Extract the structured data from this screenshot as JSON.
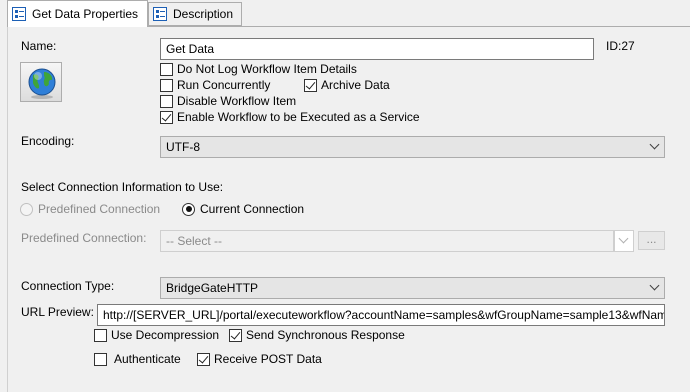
{
  "tabs": [
    {
      "label": "Get Data Properties",
      "active": true
    },
    {
      "label": "Description",
      "active": false
    }
  ],
  "form": {
    "name_label": "Name:",
    "name_value": "Get Data",
    "id_text": "ID:27",
    "options": {
      "do_not_log": {
        "label": "Do Not Log Workflow Item Details",
        "checked": false
      },
      "run_concurrently": {
        "label": "Run Concurrently",
        "checked": false
      },
      "archive_data": {
        "label": "Archive Data",
        "checked": true
      },
      "disable_item": {
        "label": "Disable Workflow Item",
        "checked": false
      },
      "enable_service": {
        "label": "Enable Workflow to be Executed as a Service",
        "checked": true
      }
    },
    "encoding_label": "Encoding:",
    "encoding_value": "UTF-8",
    "connection_section_label": "Select Connection Information to Use:",
    "radio_predefined": "Predefined Connection",
    "radio_current": "Current Connection",
    "selected_connection_mode": "Current Connection",
    "predefined_label": "Predefined Connection:",
    "predefined_value": "-- Select --",
    "ellipsis_label": "...",
    "connection_type_label": "Connection Type:",
    "connection_type_value": "BridgeGateHTTP",
    "url_preview_label": "URL Preview:",
    "url_preview_value": "http://[SERVER_URL]/portal/executeworkflow?accountName=samples&wfGroupName=sample13&wfName=Get Data",
    "use_decompression": {
      "label": "Use Decompression",
      "checked": false
    },
    "send_sync": {
      "label": "Send Synchronous Response",
      "checked": true
    },
    "authenticate": {
      "label": "Authenticate",
      "checked": false
    },
    "receive_post": {
      "label": "Receive POST Data",
      "checked": true
    }
  },
  "icons": {
    "tab_icon": "properties-icon",
    "workflow_icon": "globe-icon",
    "accent_color": "#1c5fb5"
  }
}
